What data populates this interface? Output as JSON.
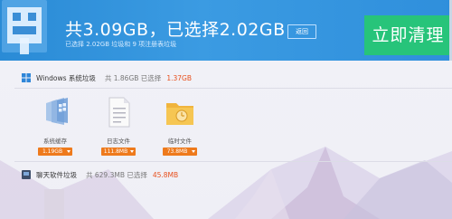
{
  "header": {
    "title": "共3.09GB，已选择2.02GB",
    "subtitle": "已选择 2.02GB 垃圾和 9 项注册表垃圾",
    "back_label": "返回",
    "clean_label": "立即清理"
  },
  "sections": [
    {
      "name": "Windows 系统垃圾",
      "total": "共 1.86GB 已选择",
      "selected": "1.37GB",
      "items": [
        {
          "label": "系统缓存",
          "size": "1.19GB",
          "icon": "system-cache-icon"
        },
        {
          "label": "日志文件",
          "size": "111.8MB",
          "icon": "log-file-icon"
        },
        {
          "label": "临时文件",
          "size": "73.8MB",
          "icon": "temp-folder-icon"
        }
      ]
    },
    {
      "name": "聊天软件垃圾",
      "total": "共 629.3MB 已选择",
      "selected": "45.8MB",
      "items": []
    }
  ],
  "colors": {
    "header_blue": "#2f8fdc",
    "clean_green": "#27c47a",
    "badge_orange": "#ee7a1c",
    "highlight": "#e8501d"
  }
}
